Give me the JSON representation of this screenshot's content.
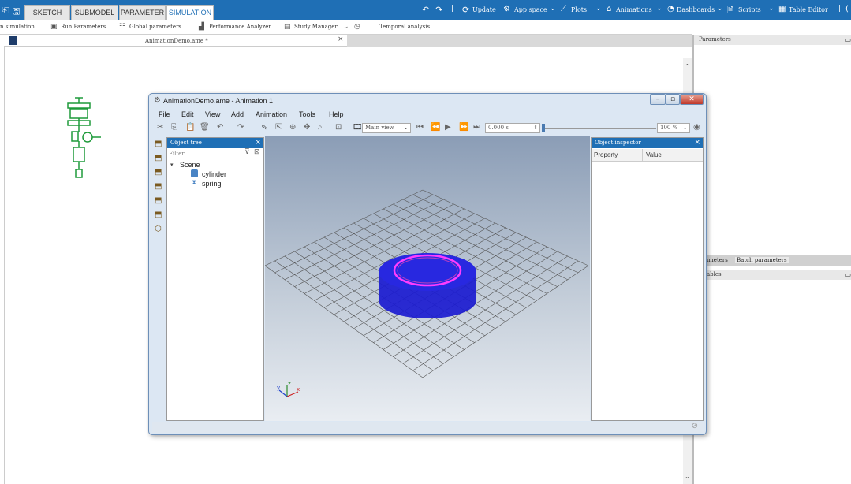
{
  "ribbon": {
    "tabs": [
      "SKETCH",
      "SUBMODEL",
      "PARAMETER",
      "SIMULATION"
    ],
    "active_tab": "SIMULATION",
    "items": [
      "Update",
      "App space",
      "Plots",
      "Animations",
      "Dashboards",
      "Scripts",
      "Table Editor"
    ]
  },
  "sim_toolbar": {
    "start_simulation": "n simulation",
    "run_parameters": "Run Parameters",
    "global_parameters": "Global parameters",
    "performance_analyzer": "Performance Analyzer",
    "study_manager": "Study Manager",
    "temporal_analysis": "Temporal analysis"
  },
  "document": {
    "tab_title": "AnimationDemo.ame *"
  },
  "right_panel": {
    "parameters_title": "Parameters",
    "tab_parameters": "ameters",
    "tab_batch": "Batch parameters",
    "variables_title": "ables"
  },
  "anim_window": {
    "title": "AnimationDemo.ame - Animation 1",
    "menu": [
      "File",
      "Edit",
      "View",
      "Add",
      "Animation",
      "Tools",
      "Help"
    ],
    "view_select": "Main view",
    "time_value": "0.000 s",
    "zoom_value": "100 %",
    "object_tree": {
      "title": "Object tree",
      "filter_placeholder": "Filter",
      "root": "Scene",
      "children": [
        "cylinder",
        "spring"
      ]
    },
    "object_inspector": {
      "title": "Object inspector",
      "columns": [
        "Property",
        "Value"
      ]
    },
    "colors": {
      "cylinder_fill": "#2a2ad6",
      "ring": "#ff40ff",
      "header": "#1f6fb5"
    }
  }
}
